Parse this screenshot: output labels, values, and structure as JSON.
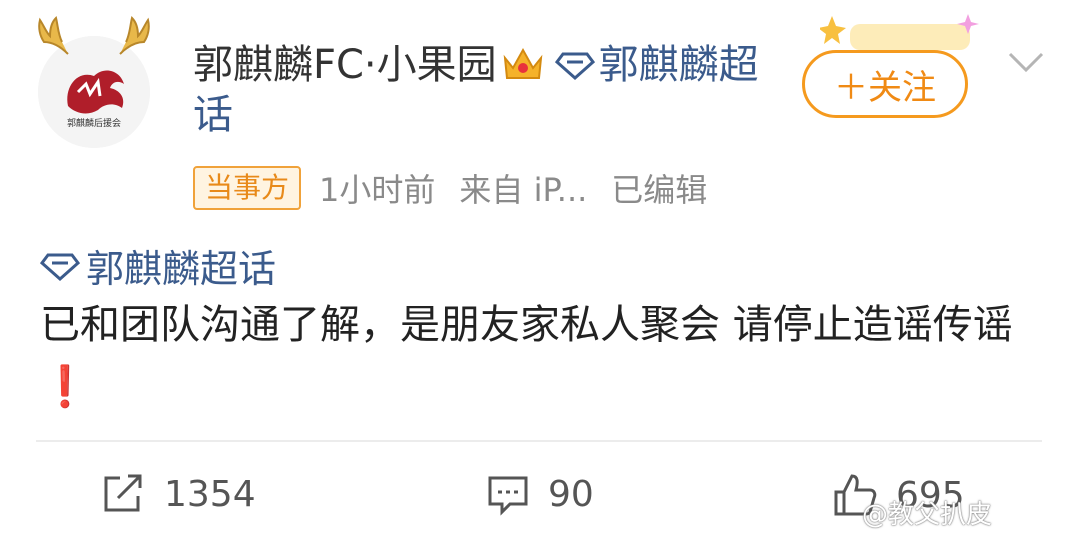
{
  "post": {
    "author_name": "郭麒麟FC·小果园",
    "supertopic_tag": "郭麒麟超话",
    "avatar_caption": "郭麒麟后援会",
    "follow_label": "＋关注",
    "party_badge": "当事方",
    "time": "1小时前",
    "source": "来自 iP...",
    "edited": "已编辑",
    "topic": "郭麒麟超话",
    "body": "已和团队沟通了解，是朋友家私人聚会 请停止造谣传谣",
    "body_emoji": "❗"
  },
  "actions": {
    "share_count": "1354",
    "comment_count": "90",
    "like_count": "695"
  },
  "watermark": "@教父扒皮",
  "colors": {
    "accent_orange": "#f59a1e",
    "link_blue": "#3b5b8c",
    "alert_red": "#e0282e"
  }
}
